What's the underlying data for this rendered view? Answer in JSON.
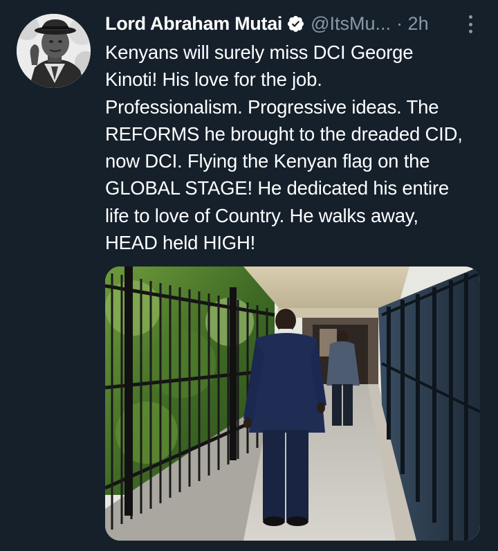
{
  "tweet": {
    "author": {
      "display_name": "Lord Abraham Mutai",
      "verified_icon": "verified-badge-icon",
      "handle": "@ItsMu...",
      "time": "· 2h"
    },
    "more_icon": "more-options-icon",
    "text_lines": [
      "Kenyans will surely miss DCI George",
      "Kinoti! His love for the job.",
      "Professionalism. Progressive ideas. The",
      "REFORMS he brought to the dreaded CID,",
      "now DCI. Flying the Kenyan flag on the",
      "GLOBAL STAGE! He dedicated his entire",
      "life to love of Country. He walks away,",
      "HEAD held HIGH!"
    ]
  },
  "colors": {
    "background": "#15202b",
    "text": "#ffffff",
    "secondary_text": "#8b98a5"
  }
}
